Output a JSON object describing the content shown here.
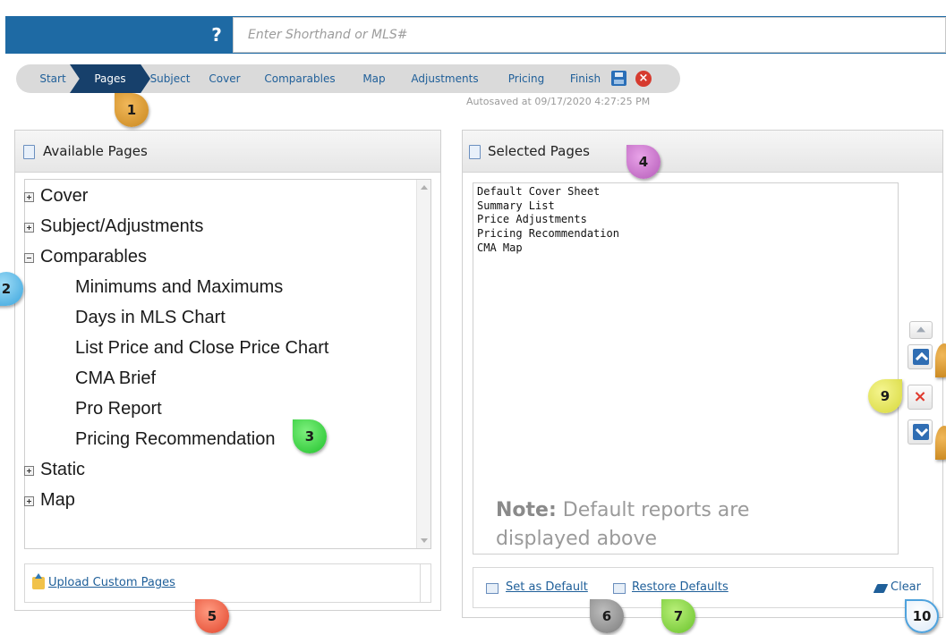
{
  "search": {
    "placeholder": "Enter Shorthand or MLS#",
    "help_icon": "question-circle-icon"
  },
  "wizard": {
    "steps": [
      {
        "label": "Start",
        "active": false
      },
      {
        "label": "Pages",
        "active": true
      },
      {
        "label": "Subject",
        "active": false
      },
      {
        "label": "Cover",
        "active": false
      },
      {
        "label": "Comparables",
        "active": false
      },
      {
        "label": "Map",
        "active": false
      },
      {
        "label": "Adjustments",
        "active": false
      },
      {
        "label": "Pricing",
        "active": false
      },
      {
        "label": "Finish",
        "active": false
      }
    ],
    "save_icon": "floppy-disk-icon",
    "cancel_icon": "close-circle-icon",
    "autosave": "Autosaved at 09/17/2020 4:27:25 PM",
    "active_color": "#17406b"
  },
  "available": {
    "title": "Available Pages",
    "tree": [
      {
        "label": "Cover",
        "state": "collapsed",
        "level": 0
      },
      {
        "label": "Subject/Adjustments",
        "state": "collapsed",
        "level": 0
      },
      {
        "label": "Comparables",
        "state": "expanded",
        "level": 0
      },
      {
        "label": "Minimums and Maximums",
        "level": 1
      },
      {
        "label": "Days in MLS Chart",
        "level": 1
      },
      {
        "label": "List Price and Close Price Chart",
        "level": 1
      },
      {
        "label": "CMA Brief",
        "level": 1
      },
      {
        "label": "Pro Report",
        "level": 1
      },
      {
        "label": "Pricing Recommendation",
        "level": 1
      },
      {
        "label": "Static",
        "state": "collapsed",
        "level": 0
      },
      {
        "label": "Map",
        "state": "collapsed",
        "level": 0
      }
    ],
    "upload_label": "Upload Custom Pages"
  },
  "selected": {
    "title": "Selected Pages",
    "items": [
      "Default Cover Sheet",
      "Summary List",
      "Price Adjustments",
      "Pricing Recommendation",
      "CMA Map"
    ],
    "note_bold": "Note:",
    "note_text": " Default reports are displayed above",
    "set_default": "Set as Default",
    "restore_defaults": "Restore Defaults",
    "clear": "Clear"
  },
  "callouts": [
    "1",
    "2",
    "3",
    "4",
    "5",
    "6",
    "7",
    "9",
    "10"
  ],
  "colors": {
    "topbar": "#1e6aa4",
    "link": "#1f5f99",
    "remove": "#e03a2e"
  }
}
